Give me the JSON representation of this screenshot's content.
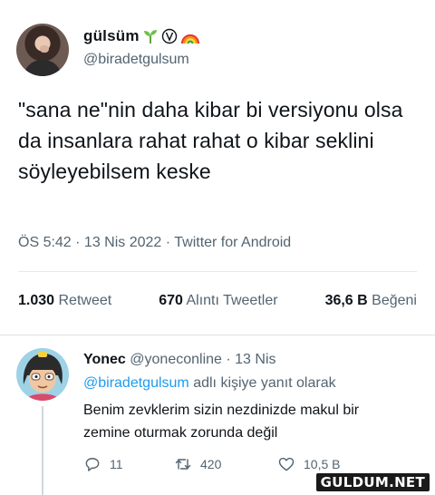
{
  "tweet": {
    "author_name": "gülsüm",
    "handle": "@biradetgulsum",
    "text": "\"sana ne\"nin daha kibar bi versiyonu olsa da insanlara rahat rahat o kibar seklini söyleyebilsem keske",
    "meta": "ÖS 5:42 · 13 Nis 2022 · Twitter for Android",
    "stats": {
      "retweets_value": "1.030",
      "retweets_label": "Retweet",
      "quotes_value": "670",
      "quotes_label": "Alıntı Tweetler",
      "likes_value": "36,6 B",
      "likes_label": "Beğeni"
    }
  },
  "reply": {
    "author_name": "Yonec",
    "handle": "@yoneconline",
    "dot": "·",
    "date": "13 Nis",
    "reply_to_mention": "@biradetgulsum",
    "reply_to_suffix": "adlı kişiye yanıt olarak",
    "text": "Benim zevklerim sizin nezdinizde makul bir zemine oturmak zorunda değil",
    "actions": {
      "replies": "11",
      "retweets": "420",
      "likes": "10,5 B"
    }
  },
  "watermark": "GULDUM.NET",
  "colors": {
    "link": "#1d9bf0",
    "secondary_text": "#536471",
    "primary_text": "#0f1419"
  },
  "icons": [
    "seedling-icon",
    "circled-v-icon",
    "rainbow-icon",
    "reply-icon",
    "retweet-icon",
    "like-icon"
  ]
}
